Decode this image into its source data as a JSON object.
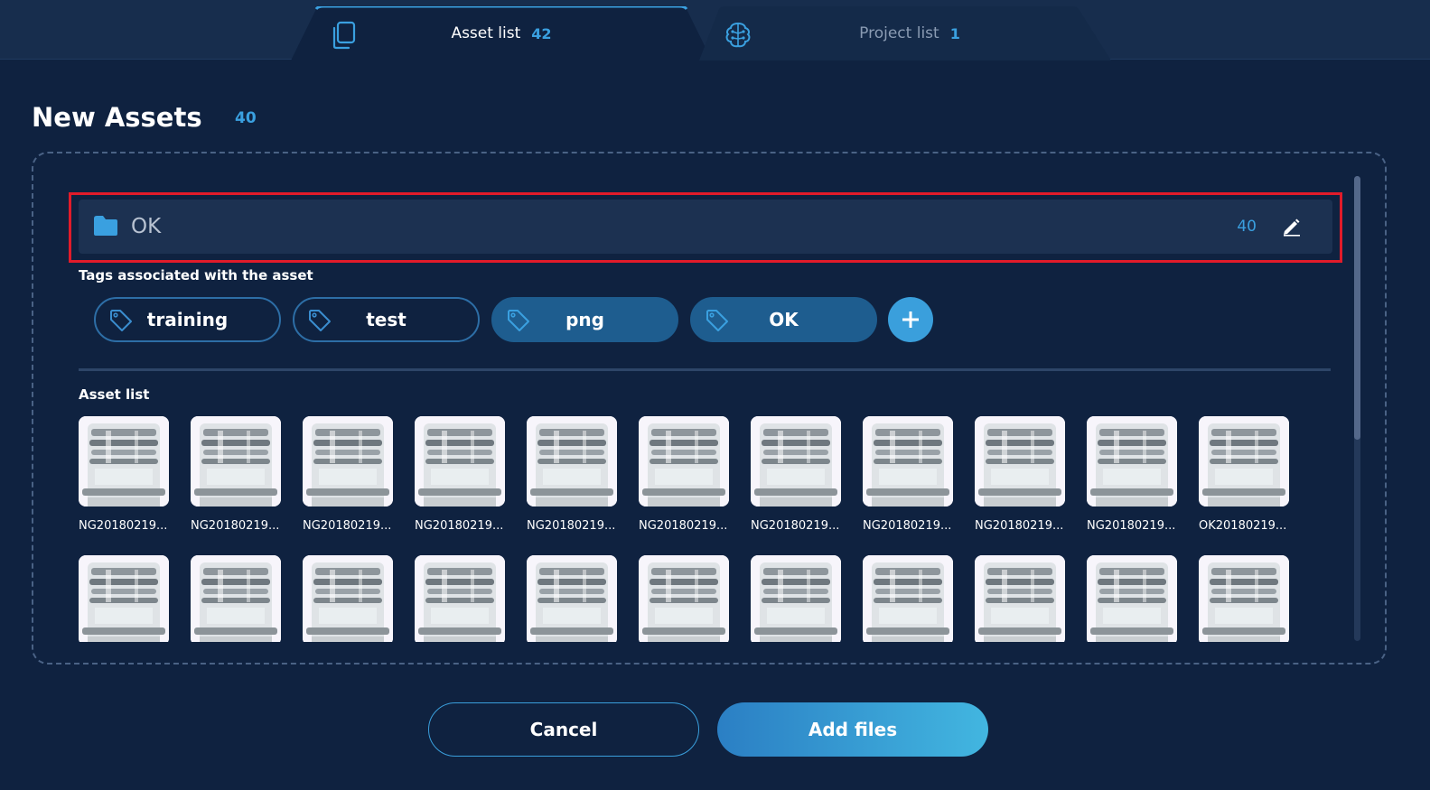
{
  "tabs": [
    {
      "label": "Asset list",
      "count": "42",
      "icon": "copy-icon"
    },
    {
      "label": "Project list",
      "count": "1",
      "icon": "brain-icon"
    }
  ],
  "section": {
    "title": "New Assets",
    "count": "40"
  },
  "folder": {
    "name": "OK",
    "count": "40",
    "icon": "folder-icon",
    "edit_icon": "pencil-icon"
  },
  "tags_label": "Tags associated with the asset",
  "tags": [
    {
      "label": "training",
      "selected": false
    },
    {
      "label": "test",
      "selected": false
    },
    {
      "label": "png",
      "selected": true
    },
    {
      "label": "OK",
      "selected": true
    }
  ],
  "assets_label": "Asset list",
  "assets_row1": [
    "NG20180219...",
    "NG20180219...",
    "NG20180219...",
    "NG20180219...",
    "NG20180219...",
    "NG20180219...",
    "NG20180219...",
    "NG20180219...",
    "NG20180219...",
    "NG20180219...",
    "OK20180219..."
  ],
  "assets_row2_count": 11,
  "buttons": {
    "cancel": "Cancel",
    "add": "Add files"
  },
  "colors": {
    "accent": "#3aa0e0",
    "highlight": "#e11b2a",
    "background": "#0f2240"
  }
}
